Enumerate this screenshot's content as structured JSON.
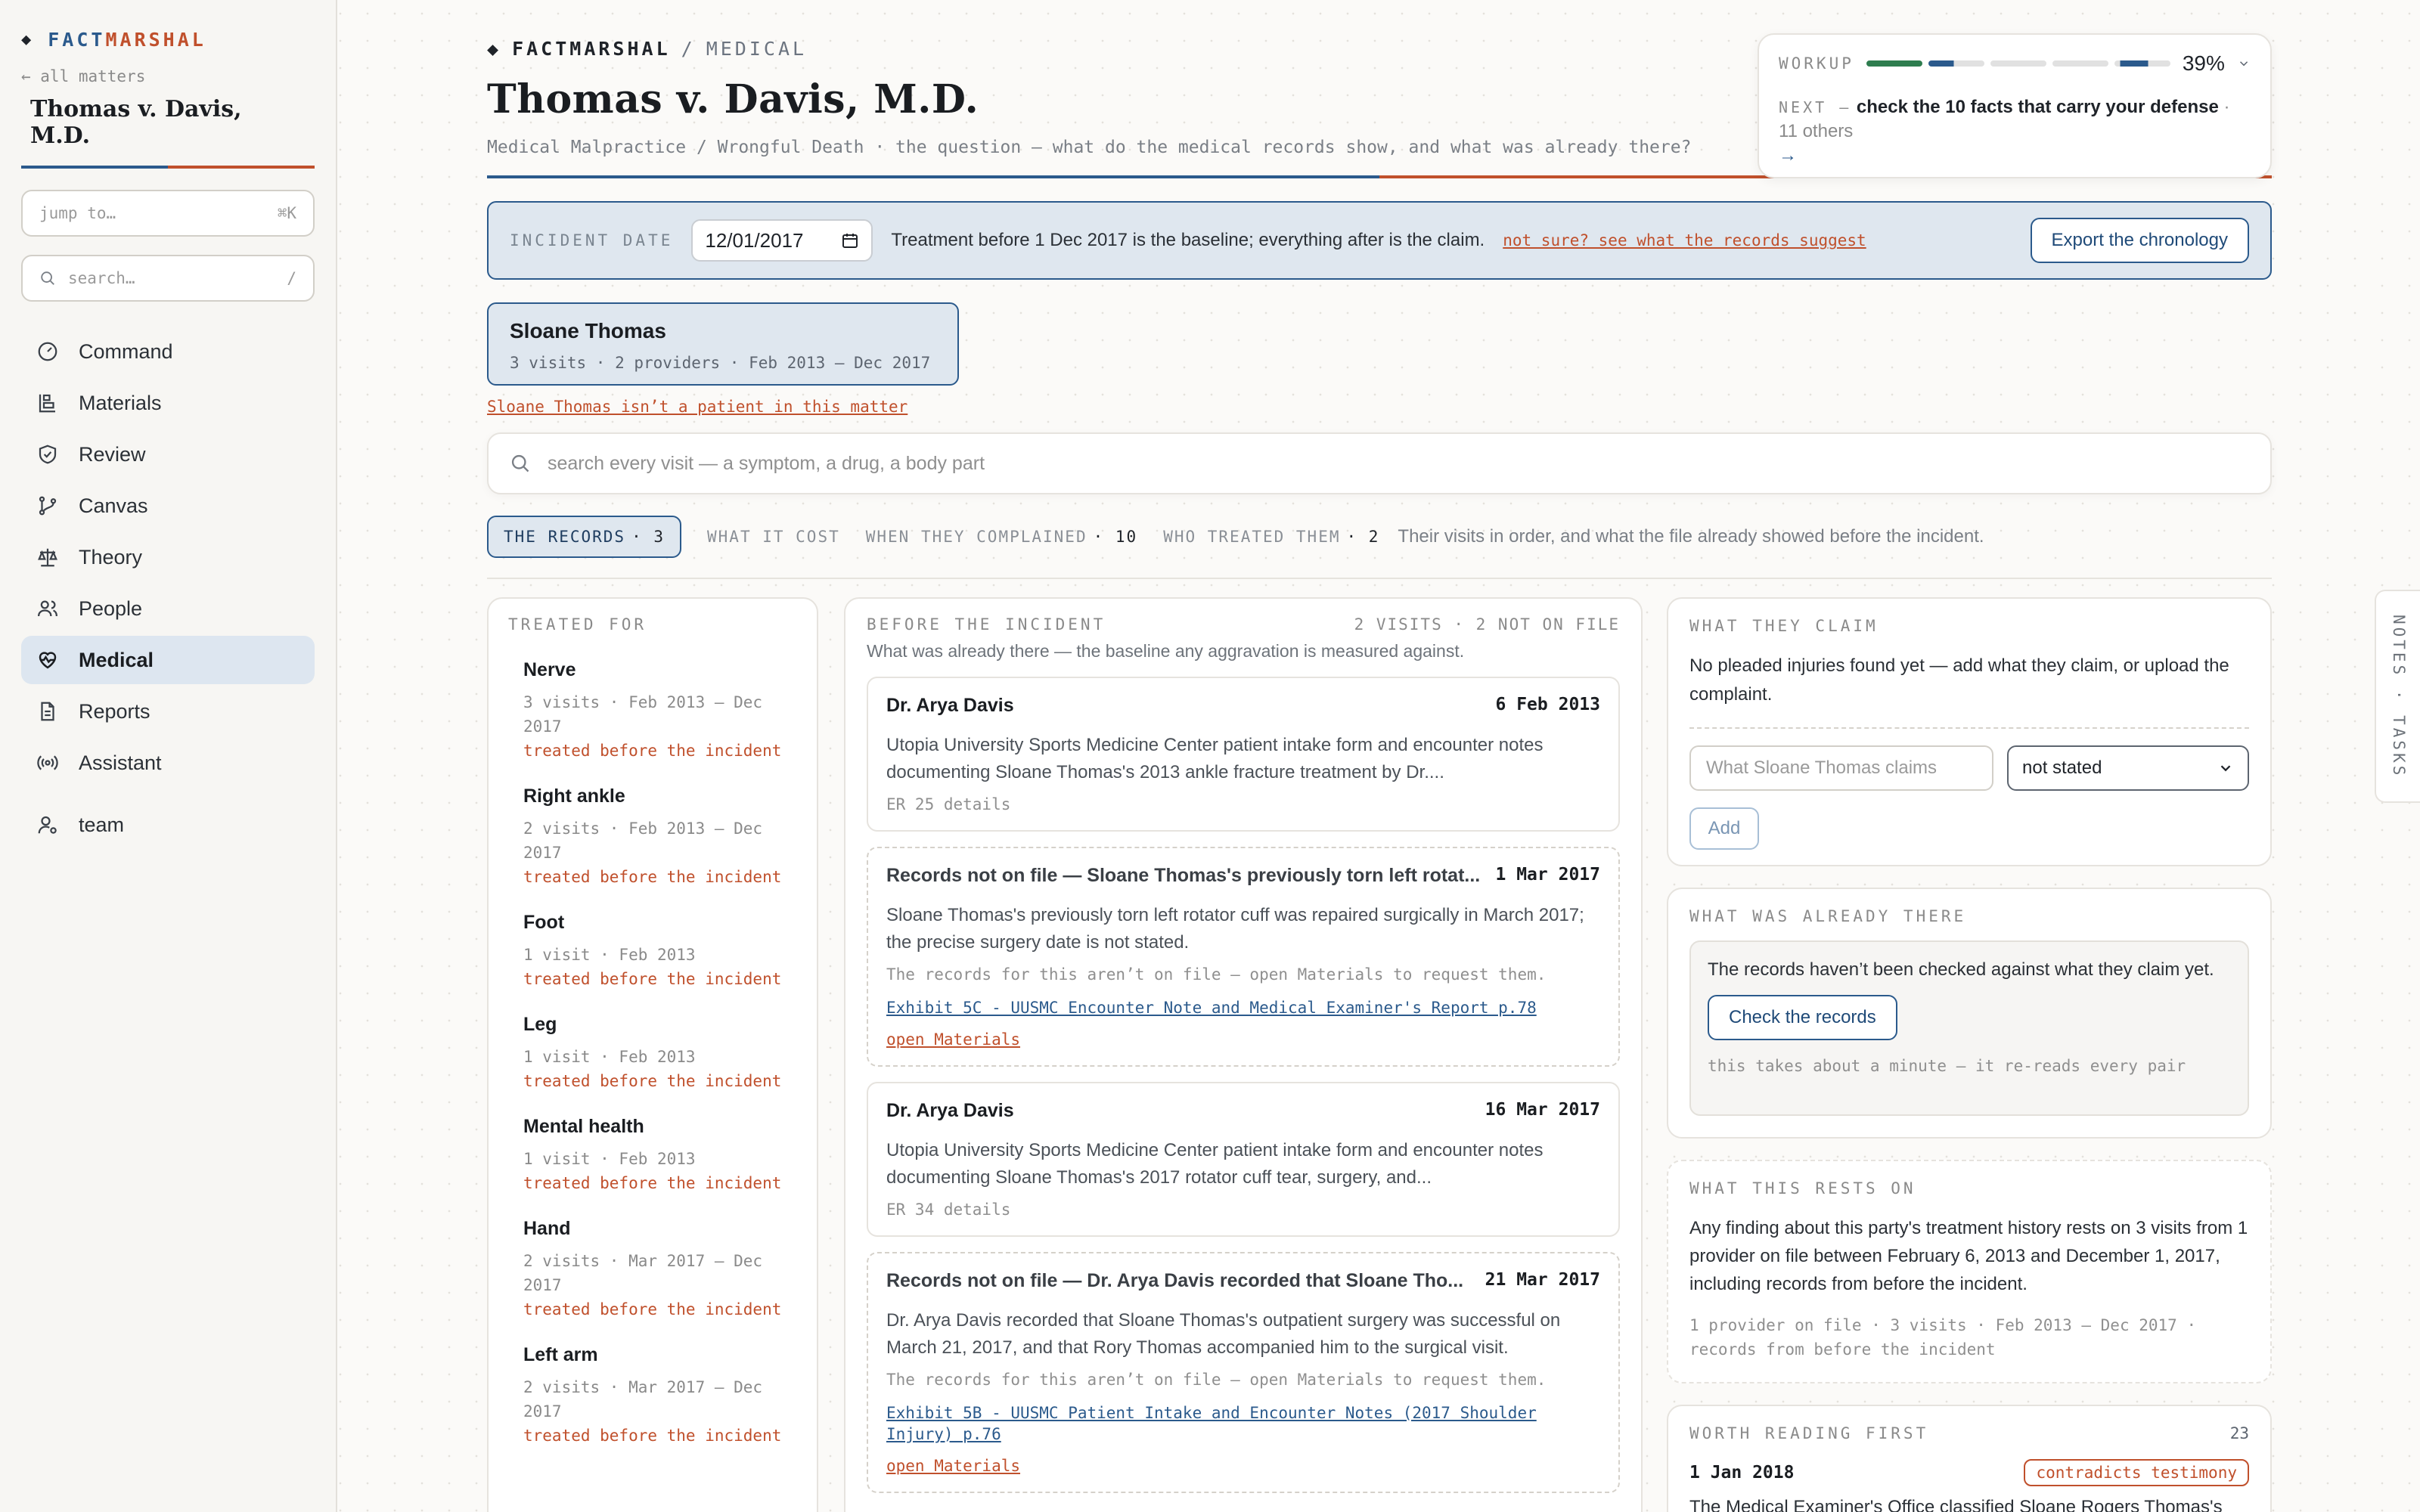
{
  "brand": {
    "part1": "FACT",
    "part2": "MARSHAL"
  },
  "sidebar": {
    "back_link": "← all matters",
    "matter_title": "Thomas v. Davis, M.D.",
    "jump": {
      "placeholder": "jump to…",
      "shortcut": "⌘K"
    },
    "search": {
      "placeholder": "search…",
      "shortcut": "/"
    },
    "items": [
      {
        "label": "Command",
        "icon": "gauge-icon"
      },
      {
        "label": "Materials",
        "icon": "materials-icon"
      },
      {
        "label": "Review",
        "icon": "shield-icon"
      },
      {
        "label": "Canvas",
        "icon": "branch-icon"
      },
      {
        "label": "Theory",
        "icon": "scales-icon"
      },
      {
        "label": "People",
        "icon": "people-icon"
      },
      {
        "label": "Medical",
        "icon": "heartbeat-icon",
        "active": true
      },
      {
        "label": "Reports",
        "icon": "document-icon"
      },
      {
        "label": "Assistant",
        "icon": "broadcast-icon"
      }
    ],
    "team": {
      "label": "team",
      "icon": "user-gear-icon"
    }
  },
  "header": {
    "crumb_brand": "FACTMARSHAL",
    "crumb_sep": "/",
    "crumb_section": "MEDICAL",
    "title": "Thomas v. Davis, M.D.",
    "subtitle": "Medical Malpractice / Wrongful Death · the question — what do the medical records show, and what was already there?"
  },
  "workup": {
    "label": "WORKUP",
    "percent": "39%",
    "segments": [
      {
        "status": "done",
        "color": "#2e7d4f"
      },
      {
        "status": "partial",
        "color": "#2b5a8c",
        "fill": 0.4
      },
      {
        "status": "todo"
      },
      {
        "status": "todo"
      },
      {
        "status": "partial",
        "color": "#2b5a8c",
        "fill": 0.6
      }
    ],
    "next_key": "NEXT –",
    "next_text": "check the 10 facts that carry your defense",
    "next_others": "· 11 others",
    "arrow": "→"
  },
  "incident": {
    "label": "INCIDENT DATE",
    "date_value": "12/01/2017",
    "text": "Treatment before 1 Dec 2017 is the baseline; everything after is the claim.",
    "link": "not sure? see what the records suggest",
    "export_label": "Export the chronology"
  },
  "patient": {
    "name": "Sloane Thomas",
    "meta": "3 visits · 2 providers · Feb 2013 – Dec 2017",
    "not_patient_link": "Sloane Thomas isn’t a patient in this matter"
  },
  "visit_search": {
    "placeholder": "search every visit — a symptom, a drug, a body part"
  },
  "tabs": [
    {
      "label": "THE RECORDS",
      "count": "· 3",
      "active": true
    },
    {
      "label": "WHAT IT COST",
      "count": ""
    },
    {
      "label": "WHEN THEY COMPLAINED",
      "count": "· 10"
    },
    {
      "label": "WHO TREATED THEM",
      "count": "· 2"
    }
  ],
  "tabs_description": "Their visits in order, and what the file already showed before the incident.",
  "treated_for": {
    "label": "TREATED FOR",
    "items": [
      {
        "name": "Nerve",
        "meta": "3 visits · Feb 2013 – Dec 2017",
        "flag": "treated before the incident"
      },
      {
        "name": "Right ankle",
        "meta": "2 visits · Feb 2013 – Dec 2017",
        "flag": "treated before the incident"
      },
      {
        "name": "Foot",
        "meta": "1 visit · Feb 2013",
        "flag": "treated before the incident"
      },
      {
        "name": "Leg",
        "meta": "1 visit · Feb 2013",
        "flag": "treated before the incident"
      },
      {
        "name": "Mental health",
        "meta": "1 visit · Feb 2013",
        "flag": "treated before the incident"
      },
      {
        "name": "Hand",
        "meta": "2 visits · Mar 2017 – Dec 2017",
        "flag": "treated before the incident"
      },
      {
        "name": "Left arm",
        "meta": "2 visits · Mar 2017 – Dec 2017",
        "flag": "treated before the incident"
      }
    ]
  },
  "before": {
    "label": "BEFORE THE INCIDENT",
    "count": "2 VISITS · 2 NOT ON FILE",
    "description": "What was already there — the baseline any aggravation is measured against.",
    "visits": [
      {
        "title": "Dr. Arya Davis",
        "date": "6 Feb 2013",
        "body": "Utopia University Sports Medicine Center patient intake form and encounter notes documenting Sloane Thomas's 2013 ankle fracture treatment by Dr....",
        "foot": "ER 25 details"
      },
      {
        "missing": true,
        "title": "Records not on file — Sloane Thomas's previously torn left rotat...",
        "date": "1 Mar 2017",
        "body": "Sloane Thomas's previously torn left rotator cuff was repaired surgically in March 2017; the precise surgery date is not stated.",
        "foot": "The records for this aren’t on file — open Materials to request them.",
        "exhibit": "Exhibit 5C - UUSMC Encounter Note and Medical Examiner's Report p.78",
        "open": "open Materials"
      },
      {
        "title": "Dr. Arya Davis",
        "date": "16 Mar 2017",
        "body": "Utopia University Sports Medicine Center patient intake form and encounter notes documenting Sloane Thomas's 2017 rotator cuff tear, surgery, and...",
        "foot": "ER 34 details"
      },
      {
        "missing": true,
        "title": "Records not on file — Dr. Arya Davis recorded that Sloane Tho...",
        "date": "21 Mar 2017",
        "body": "Dr. Arya Davis recorded that Sloane Thomas's outpatient surgery was successful on March 21, 2017, and that Rory Thomas accompanied him to the surgical visit.",
        "foot": "The records for this aren’t on file — open Materials to request them.",
        "exhibit": "Exhibit 5B - UUSMC Patient Intake and Encounter Notes (2017 Shoulder Injury) p.76",
        "open": "open Materials"
      }
    ]
  },
  "claim": {
    "label": "WHAT THEY CLAIM",
    "text": "No pleaded injuries found yet — add what they claim, or upload the complaint.",
    "input_placeholder": "What Sloane Thomas claims",
    "select_value": "not stated",
    "add_label": "Add"
  },
  "already": {
    "label": "WHAT WAS ALREADY THERE",
    "text": "The records haven’t been checked against what they claim yet.",
    "button": "Check the records",
    "note": "this takes about a minute — it re-reads every pair"
  },
  "rests": {
    "label": "WHAT THIS RESTS ON",
    "text": "Any finding about this party's treatment history rests on 3 visits from 1 provider on file between February 6, 2013 and December 1, 2017, including records from before the incident.",
    "meta": "1 provider on file · 3 visits · Feb 2013 – Dec 2017 · records from before the incident"
  },
  "worth": {
    "label": "WORTH READING FIRST",
    "count": "23",
    "date": "1 Jan 2018",
    "badge": "contradicts testimony",
    "text": "The Medical Examiner's Office classified Sloane Rogers Thomas's"
  },
  "notes_tab": "NOTES · TASKS",
  "colors": {
    "accent_blue": "#2b5a8c",
    "accent_red": "#c0502c",
    "active_bg": "#dfe7ef"
  }
}
